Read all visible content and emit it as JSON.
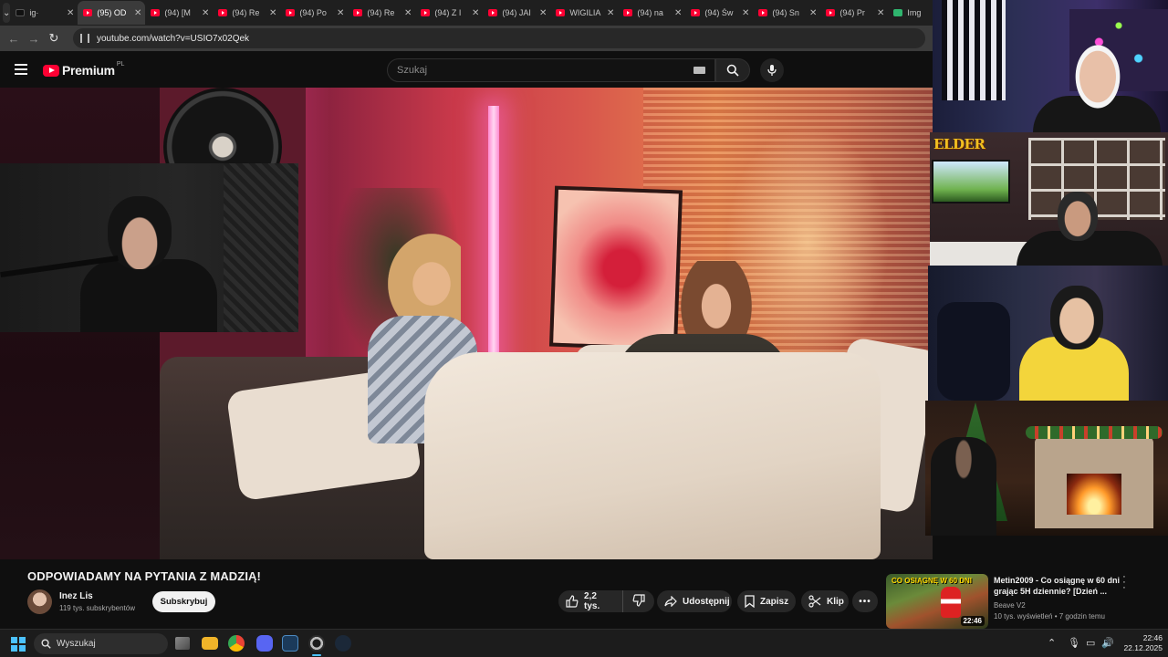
{
  "browser": {
    "tabs": [
      {
        "label": "ig·",
        "favicon": "tiktok-icon",
        "active": false
      },
      {
        "label": "(95) OD",
        "favicon": "youtube-icon",
        "active": true
      },
      {
        "label": "(94) [M",
        "favicon": "youtube-icon",
        "active": false
      },
      {
        "label": "(94) Re",
        "favicon": "youtube-icon",
        "active": false
      },
      {
        "label": "(94) Po",
        "favicon": "youtube-icon",
        "active": false
      },
      {
        "label": "(94) Re",
        "favicon": "youtube-icon",
        "active": false
      },
      {
        "label": "(94) Z I",
        "favicon": "youtube-icon",
        "active": false
      },
      {
        "label": "(94) JAI",
        "favicon": "youtube-icon",
        "active": false
      },
      {
        "label": "WIGILIA",
        "favicon": "youtube-icon",
        "active": false
      },
      {
        "label": "(94) na",
        "favicon": "youtube-icon",
        "active": false
      },
      {
        "label": "(94) Św",
        "favicon": "youtube-icon",
        "active": false
      },
      {
        "label": "(94) Sn",
        "favicon": "youtube-icon",
        "active": false
      },
      {
        "label": "(94) Pr",
        "favicon": "youtube-icon",
        "active": false
      },
      {
        "label": "Img",
        "favicon": "image-icon",
        "active": false
      }
    ],
    "url": "youtube.com/watch?v=USIO7x02Qek"
  },
  "youtube": {
    "logo_text": "Premium",
    "region": "PL",
    "search_placeholder": "Szukaj"
  },
  "overlays": {
    "elder_badge": "ELDER"
  },
  "video": {
    "title": "ODPOWIADAMY NA PYTANIA Z MADZIĄ!",
    "channel_name": "Inez Lis",
    "subscribers": "119 tys. subskrybentów",
    "subscribe_label": "Subskrybuj",
    "likes": "2,2 tys.",
    "share_label": "Udostępnij",
    "save_label": "Zapisz",
    "clip_label": "Klip",
    "more_label": "•••"
  },
  "recommended": {
    "thumb_text": "CO OSIĄGNĘ W 60 DNI",
    "duration": "22:46",
    "title": "Metin2009 - Co osiągnę w 60 dni grając 5H dziennie? [Dzień ...",
    "channel": "Beave V2",
    "meta": "10 tys. wyświetleń • 7 godzin temu"
  },
  "taskbar": {
    "search_label": "Wyszukaj",
    "time": "22:46",
    "date": "22.12.2025"
  },
  "colors": {
    "youtube_red": "#ff0033",
    "accent_blue": "#4cc2ff",
    "hoodie_yellow": "#f3d53b"
  }
}
